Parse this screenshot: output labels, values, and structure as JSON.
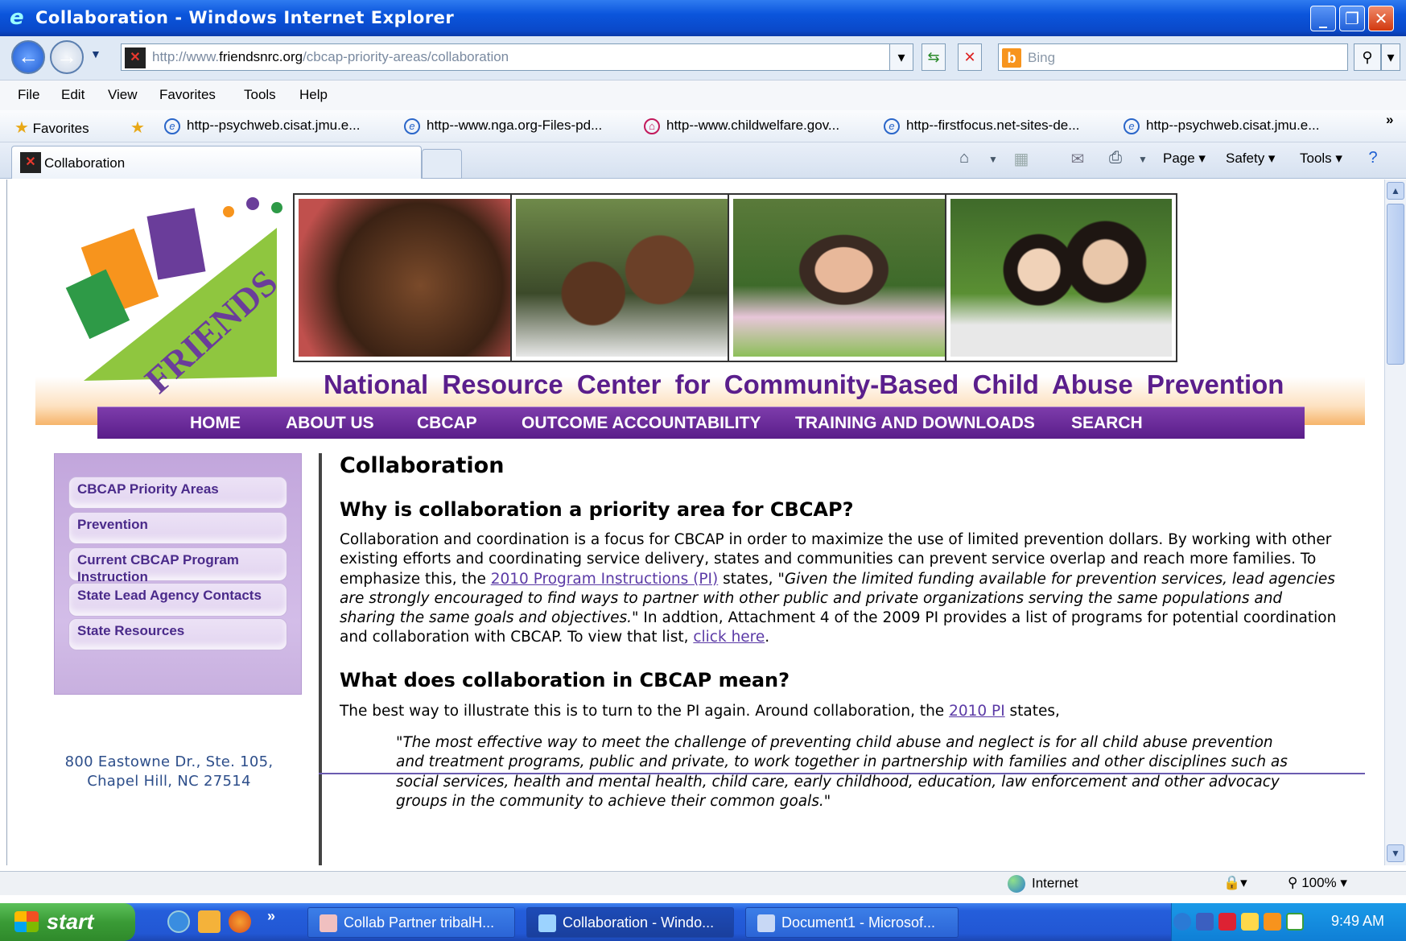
{
  "window": {
    "title": "Collaboration - Windows Internet Explorer"
  },
  "address": {
    "prefix": "http://www.",
    "domain": "friendsnrc.org",
    "path": "/cbcap-priority-areas/collaboration"
  },
  "search": {
    "placeholder": "Bing"
  },
  "menu": [
    "File",
    "Edit",
    "View",
    "Favorites",
    "Tools",
    "Help"
  ],
  "favorites": {
    "label": "Favorites",
    "items": [
      "http--psychweb.cisat.jmu.e...",
      "http--www.nga.org-Files-pd...",
      "http--www.childwelfare.gov...",
      "http--firstfocus.net-sites-de...",
      "http--psychweb.cisat.jmu.e..."
    ],
    "more": "»"
  },
  "tab": {
    "label": "Collaboration"
  },
  "commands": {
    "page": "Page ▾",
    "safety": "Safety ▾",
    "tools": "Tools ▾"
  },
  "site": {
    "logo_text": "FRIENDS",
    "logo_sub": "National Resource Center for Community-Based Child Abuse Prevention",
    "title": "National Resource Center for Community-Based Child Abuse Prevention",
    "nav": [
      "HOME",
      "ABOUT US",
      "CBCAP",
      "OUTCOME ACCOUNTABILITY",
      "TRAINING AND DOWNLOADS",
      "SEARCH"
    ]
  },
  "sidebar": {
    "items": [
      "CBCAP Priority Areas",
      "Prevention",
      "Current CBCAP Program Instruction",
      "State Lead Agency Contacts",
      "State Resources"
    ],
    "address_line1": "800 Eastowne Dr., Ste. 105,",
    "address_line2": "Chapel Hill, NC 27514"
  },
  "content": {
    "title": "Collaboration",
    "h2_1": "Why is collaboration a priority area for CBCAP?",
    "p1_a": "Collaboration and coordination is a focus for CBCAP in order to maximize the use of limited prevention dollars. By working with other existing efforts and coordinating service delivery, states and communities can prevent service overlap and reach more families. To emphasize this, the ",
    "p1_link": "2010 Program Instructions (PI)",
    "p1_b": " states, ",
    "p1_quote": "\"Given the limited funding available for prevention services, lead agencies are strongly encouraged to find ways to partner with other public and private organizations serving the same populations and sharing the same goals and objectives.\"",
    "p1_c": " In addtion, Attachment 4 of the 2009 PI provides a list of programs for potential coordination and collaboration with CBCAP. To view that list, ",
    "p1_link2": "click here",
    "p1_d": ".",
    "h2_2": "What does collaboration in CBCAP mean?",
    "p2_a": "The best way to illustrate this is to turn to the PI again. Around collaboration, the ",
    "p2_link": "2010 PI",
    "p2_b": " states,",
    "quote": "\"The most effective way to meet the challenge of preventing child abuse and neglect is for all child abuse prevention and treatment programs, public and private, to work together in partnership with families and other disciplines such as social services, health and mental health, child care, early childhood, education, law enforcement and other advocacy groups in the community to achieve their common goals.\""
  },
  "status": {
    "zone": "Internet",
    "zoom": "100%"
  },
  "taskbar": {
    "start": "start",
    "buttons": [
      "Collab Partner tribalH...",
      "Collaboration - Windo...",
      "Document1 - Microsof..."
    ],
    "clock": "9:49 AM"
  }
}
